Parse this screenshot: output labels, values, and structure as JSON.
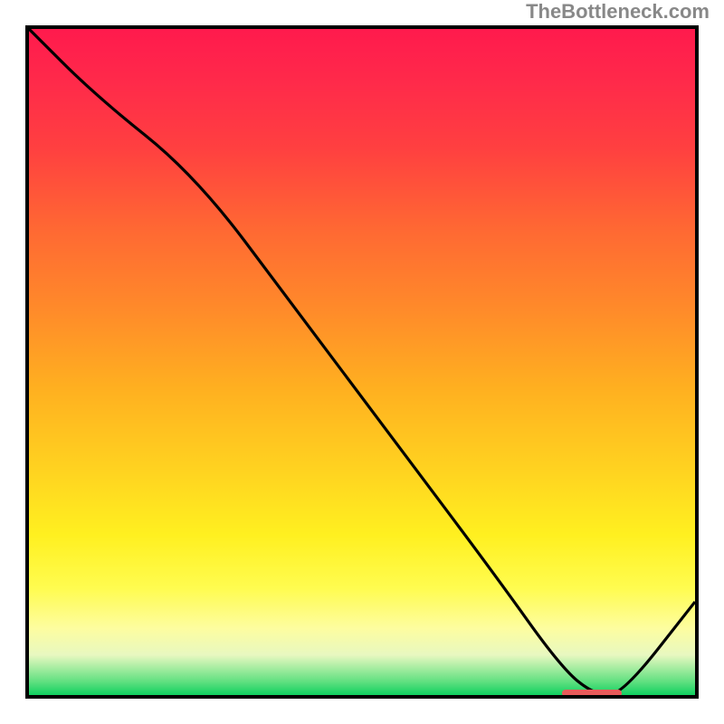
{
  "watermark": "TheBottleneck.com",
  "chart_data": {
    "type": "line",
    "title": "",
    "xlabel": "",
    "ylabel": "",
    "xlim": [
      0,
      100
    ],
    "ylim": [
      0,
      100
    ],
    "grid": false,
    "legend": false,
    "x": [
      0,
      10,
      25,
      40,
      55,
      70,
      80,
      85,
      89,
      100
    ],
    "values": [
      100,
      90,
      78,
      58,
      38,
      18,
      4,
      0,
      0,
      14
    ],
    "highlight_range_x": [
      80,
      89
    ],
    "background_gradient": {
      "top_color": "#ff1a4d",
      "bottom_color": "#10d060"
    }
  },
  "colors": {
    "curve": "#000000",
    "marker": "#e85a5a",
    "border": "#000000",
    "watermark": "#888888"
  }
}
